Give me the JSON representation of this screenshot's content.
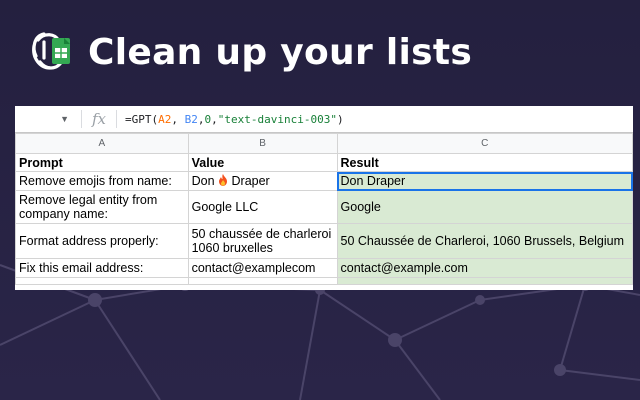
{
  "header": {
    "title": "Clean up your lists",
    "colors": {
      "title": "#ffffff",
      "background": "#24203f"
    }
  },
  "formula_bar": {
    "fx_label": "fx",
    "formula_prefix": "=GPT(",
    "ref_a": "A2",
    "sep1": ", ",
    "ref_b": "B2",
    "sep2": ",",
    "num": "0",
    "sep3": ",",
    "model": "\"text-davinci-003\"",
    "formula_suffix": ")"
  },
  "columns": [
    "A",
    "B",
    "C"
  ],
  "table": {
    "headers": [
      "Prompt",
      "Value",
      "Result"
    ],
    "rows": [
      {
        "prompt": "Remove emojis from name:",
        "value_pre": "Don",
        "value_post": "Draper",
        "emoji": "fire",
        "result": "Don Draper"
      },
      {
        "prompt": "Remove legal entity from company name:",
        "value": "Google LLC",
        "result": "Google"
      },
      {
        "prompt": "Format address properly:",
        "value": "50 chaussée de charleroi 1060 bruxelles",
        "result": "50 Chaussée de Charleroi, 1060 Brussels, Belgium"
      },
      {
        "prompt": "Fix this email address:",
        "value": "contact@examplecom",
        "result": "contact@example.com"
      }
    ]
  },
  "colors": {
    "result_fill": "#d9ead3",
    "selection": "#1a73e8",
    "ref_a": "#ff6d01",
    "ref_b": "#4285f4"
  }
}
